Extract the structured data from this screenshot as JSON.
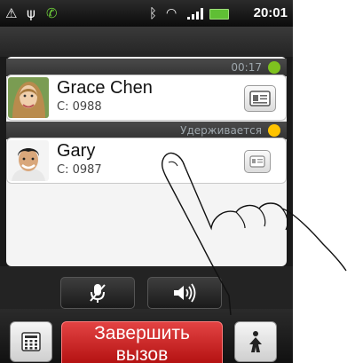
{
  "status_bar": {
    "time": "20:01",
    "icons": [
      "alert-icon",
      "usb-icon",
      "call-active-icon",
      "bluetooth-icon",
      "wifi-icon",
      "signal-icon",
      "battery-icon"
    ],
    "signal_text": ".ıl"
  },
  "calls": [
    {
      "timer": "00:17",
      "status_color": "#7ec21f",
      "name": "Grace Chen",
      "number": "C: 0988"
    },
    {
      "status_text": "Удерживается",
      "status_color": "#ffc400",
      "name": "Gary",
      "number": "C: 0987"
    }
  ],
  "controls": {
    "mute_icon": "microphone-icon",
    "speaker_icon": "speaker-icon"
  },
  "bottom": {
    "end_call_line1": "Завершить",
    "end_call_line2": "вызов",
    "keypad_icon": "dialpad-icon",
    "more_icon": "add-call-icon"
  },
  "colors": {
    "end_call": "#c81818",
    "accent_active": "#7ec21f",
    "accent_hold": "#ffc400"
  }
}
